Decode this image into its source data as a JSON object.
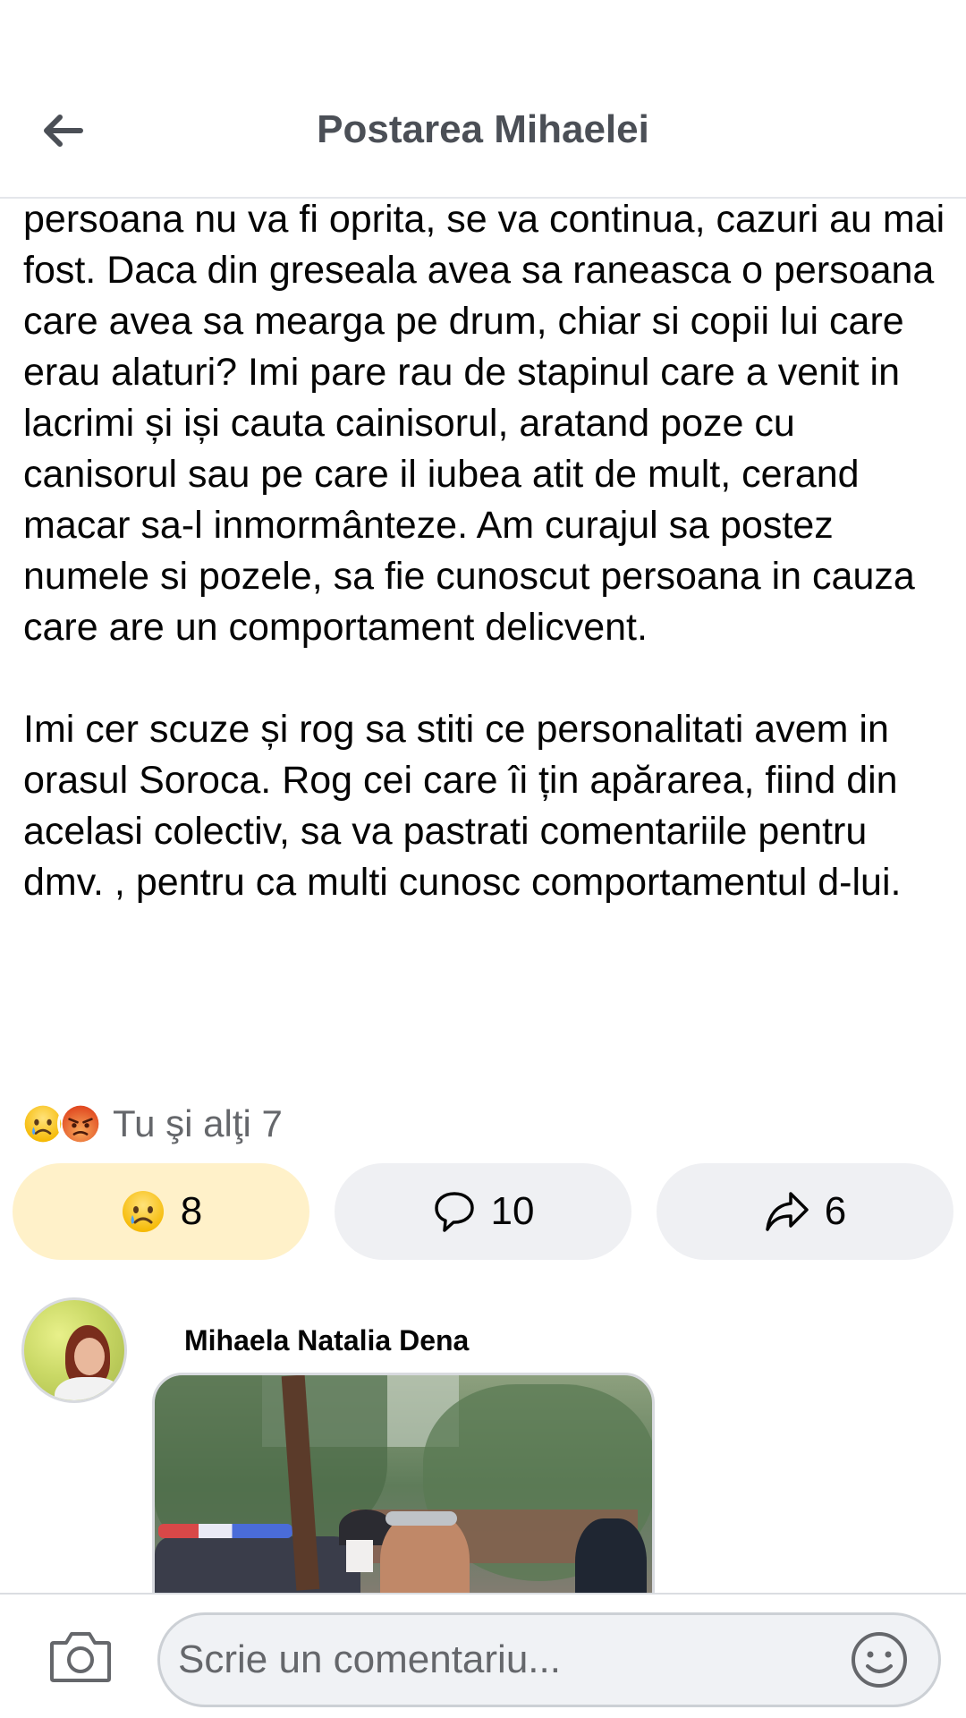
{
  "header": {
    "title": "Postarea Mihaelei",
    "back_icon": "arrow-left-icon"
  },
  "post": {
    "paragraphs": [
      "pentru, ... multi la numar, se plimba zi de zi. Daca persoana nu va fi oprita, se va continua, cazuri au mai fost. Daca din greseala avea sa raneasca o persoana care avea sa mearga pe drum, chiar si copii lui care erau alaturi? Imi pare rau de stapinul care a venit in lacrimi și iși cauta cainisorul, aratand poze cu canisorul sau pe care il iubea atit de mult, cerand macar sa-l inmormânteze. Am curajul sa postez numele si pozele, sa fie cunoscut persoana in cauza care are un comportament delicvent.",
      "Imi cer scuze și rog sa stiti ce personalitati avem in orasul Soroca. Rog cei care îi țin apărarea, fiind din acelasi colectiv, sa va pastrati comentariile pentru dmv. , pentru ca multi cunosc comportamentul d-lui."
    ]
  },
  "reactions": {
    "icons": [
      "sad-face-icon",
      "angry-face-icon"
    ],
    "summary_text": "Tu şi alţi 7"
  },
  "actions": {
    "react_count": "8",
    "comment_count": "10",
    "share_count": "6"
  },
  "comment": {
    "author": "Mihaela Natalia Dena"
  },
  "composer": {
    "placeholder": "Scrie un comentariu..."
  },
  "colors": {
    "title_gray": "#4b4f56",
    "button_bg": "#eff0f3",
    "active_reaction_bg": "#fff1c9",
    "secondary_text": "#65676b"
  }
}
